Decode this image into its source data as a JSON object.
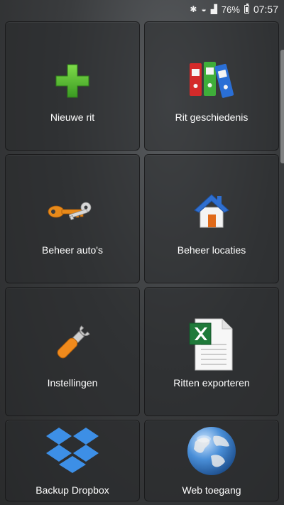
{
  "status_bar": {
    "battery": "76%",
    "time": "07:57"
  },
  "tiles": [
    {
      "label": "Nieuwe rit",
      "icon": "plus-icon"
    },
    {
      "label": "Rit geschiedenis",
      "icon": "binders-icon"
    },
    {
      "label": "Beheer auto's",
      "icon": "car-keys-icon"
    },
    {
      "label": "Beheer locaties",
      "icon": "house-icon"
    },
    {
      "label": "Instellingen",
      "icon": "wrench-icon"
    },
    {
      "label": "Ritten exporteren",
      "icon": "excel-document-icon"
    },
    {
      "label": "Backup Dropbox",
      "icon": "dropbox-icon"
    },
    {
      "label": "Web toegang",
      "icon": "globe-icon"
    }
  ],
  "colors": {
    "plus_green": "#4cb82b",
    "binder_red": "#d42a2a",
    "binder_green": "#3fae3a",
    "binder_blue": "#2a6fd6",
    "key_orange": "#e88a1a",
    "house_roof": "#2f6fd0",
    "house_door": "#e06a1a",
    "wrench_orange": "#f08a1c",
    "excel_green": "#1f7a3a",
    "dropbox_blue": "#3d8fe6",
    "globe_blue": "#2f79c9"
  }
}
